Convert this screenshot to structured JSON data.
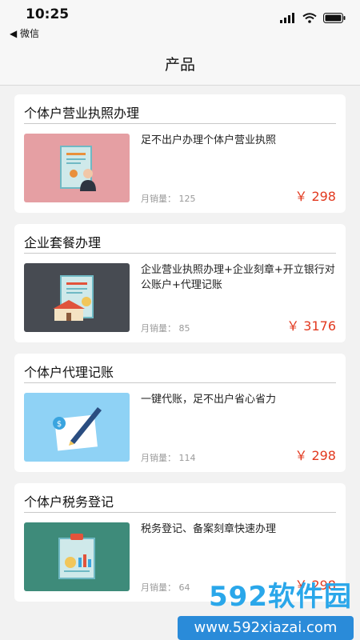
{
  "status_bar": {
    "time": "10:25",
    "back_label": "◀ 微信"
  },
  "nav": {
    "title": "产品"
  },
  "products": [
    {
      "title": "个体户营业执照办理",
      "desc": "足不出户办理个体户营业执照",
      "sales_label": "月销量：",
      "sales": "125",
      "price": "￥ 298",
      "thumb_color": "#e59fa3"
    },
    {
      "title": "企业套餐办理",
      "desc": "企业营业执照办理+企业刻章+开立银行对公账户+代理记账",
      "sales_label": "月销量：",
      "sales": "85",
      "price": "￥ 3176",
      "thumb_color": "#474b52"
    },
    {
      "title": "个体户代理记账",
      "desc": "一键代账，足不出户省心省力",
      "sales_label": "月销量：",
      "sales": "114",
      "price": "￥ 298",
      "thumb_color": "#8fd2f5"
    },
    {
      "title": "个体户税务登记",
      "desc": "税务登记、备案刻章快速办理",
      "sales_label": "月销量：",
      "sales": "64",
      "price": "￥ 298",
      "thumb_color": "#3e8b7a"
    }
  ],
  "watermark": {
    "brand": "592软件园",
    "url": "www.592xiazai.com"
  },
  "colors": {
    "price": "#e2391f",
    "background": "#f2f2f2"
  }
}
